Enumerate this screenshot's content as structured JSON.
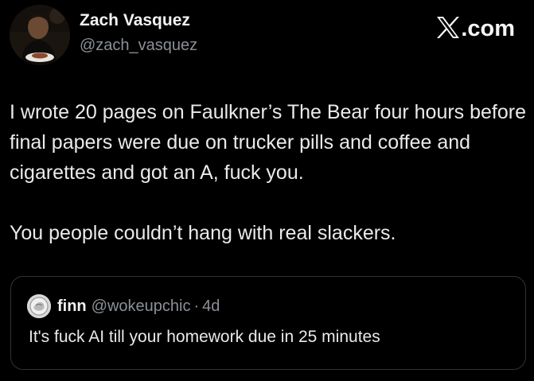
{
  "author": {
    "display_name": "Zach Vasquez",
    "handle": "@zach_vasquez",
    "avatar_icon": "profile-photo"
  },
  "brand": {
    "label": ".com",
    "icon": "x-logo-icon"
  },
  "tweet": {
    "paragraphs": [
      "I wrote 20 pages on Faulkner’s The Bear four hours before final papers were due on trucker pills and coffee and cigarettes and got an A, fuck you.",
      "You people couldn’t hang with real slackers."
    ]
  },
  "quoted_tweet": {
    "display_name": "finn",
    "handle": "@wokeupchic",
    "separator": "·",
    "time": "4d",
    "text": "It's fuck AI till your homework due in 25 minutes"
  },
  "colors": {
    "background": "#000000",
    "primary_text": "#e7e9ea",
    "secondary_text": "#8b9095",
    "border": "#2f3336"
  }
}
